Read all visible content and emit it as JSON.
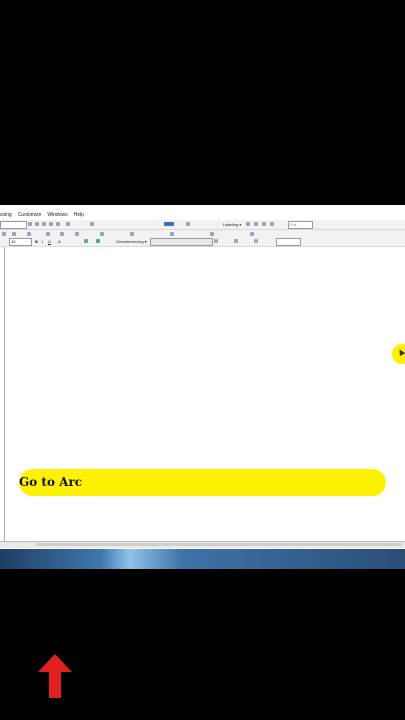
{
  "menu": {
    "items": [
      "ssing",
      "Customize",
      "Windows",
      "Help"
    ]
  },
  "toolbar": {
    "labeling_label": "Labeling ▾",
    "georeferencing_label": "Georeferencing ▾",
    "fontsize_value": "10",
    "scale_value": "Full"
  },
  "banner": {
    "text": "Go to Arc"
  },
  "colors": {
    "banner": "#fff200",
    "arrow": "#e02020",
    "cursor_highlight": "#fff000"
  },
  "icons": [
    "pointer-cursor-icon",
    "up-arrow-icon"
  ]
}
